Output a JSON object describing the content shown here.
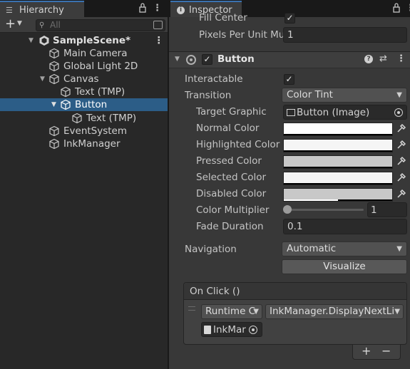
{
  "hierarchy": {
    "tab_label": "Hierarchy",
    "search_placeholder": "All",
    "rows": [
      {
        "label": "SampleScene*"
      },
      {
        "label": "Main Camera"
      },
      {
        "label": "Global Light 2D"
      },
      {
        "label": "Canvas"
      },
      {
        "label": "Text (TMP)"
      },
      {
        "label": "Button"
      },
      {
        "label": "Text (TMP)"
      },
      {
        "label": "EventSystem"
      },
      {
        "label": "InkManager"
      }
    ]
  },
  "inspector": {
    "tab_label": "Inspector",
    "fill_center_label": "Fill Center",
    "fill_center_checked": "✓",
    "ppu_label": "Pixels Per Unit Mu",
    "ppu_value": "1",
    "component": {
      "enabled_check": "✓",
      "title": "Button",
      "interactable_label": "Interactable",
      "interactable_check": "✓",
      "transition_label": "Transition",
      "transition_value": "Color Tint",
      "target_graphic_label": "Target Graphic",
      "target_graphic_value": "Button (Image)",
      "colors": [
        {
          "label": "Normal Color",
          "color": "#ffffff"
        },
        {
          "label": "Highlighted Color",
          "color": "#f5f5f5"
        },
        {
          "label": "Pressed Color",
          "color": "#c8c8c8"
        },
        {
          "label": "Selected Color",
          "color": "#f5f5f5"
        },
        {
          "label": "Disabled Color",
          "color": "#c8c8c8",
          "alpha": 0.5
        }
      ],
      "color_multiplier_label": "Color Multiplier",
      "color_multiplier_value": "1",
      "color_multiplier_slider": 0.0,
      "fade_duration_label": "Fade Duration",
      "fade_duration_value": "0.1",
      "navigation_label": "Navigation",
      "navigation_value": "Automatic",
      "visualize_label": "Visualize",
      "on_click_label": "On Click ()",
      "runtime_value": "Runtime C",
      "function_value": "InkManager.DisplayNextLi",
      "object_value": "InkMar"
    },
    "add_label": "+",
    "remove_label": "−"
  },
  "colors": {
    "selection": "#2c5d87",
    "panel": "#383838",
    "hierarchy_bg": "#282828"
  }
}
